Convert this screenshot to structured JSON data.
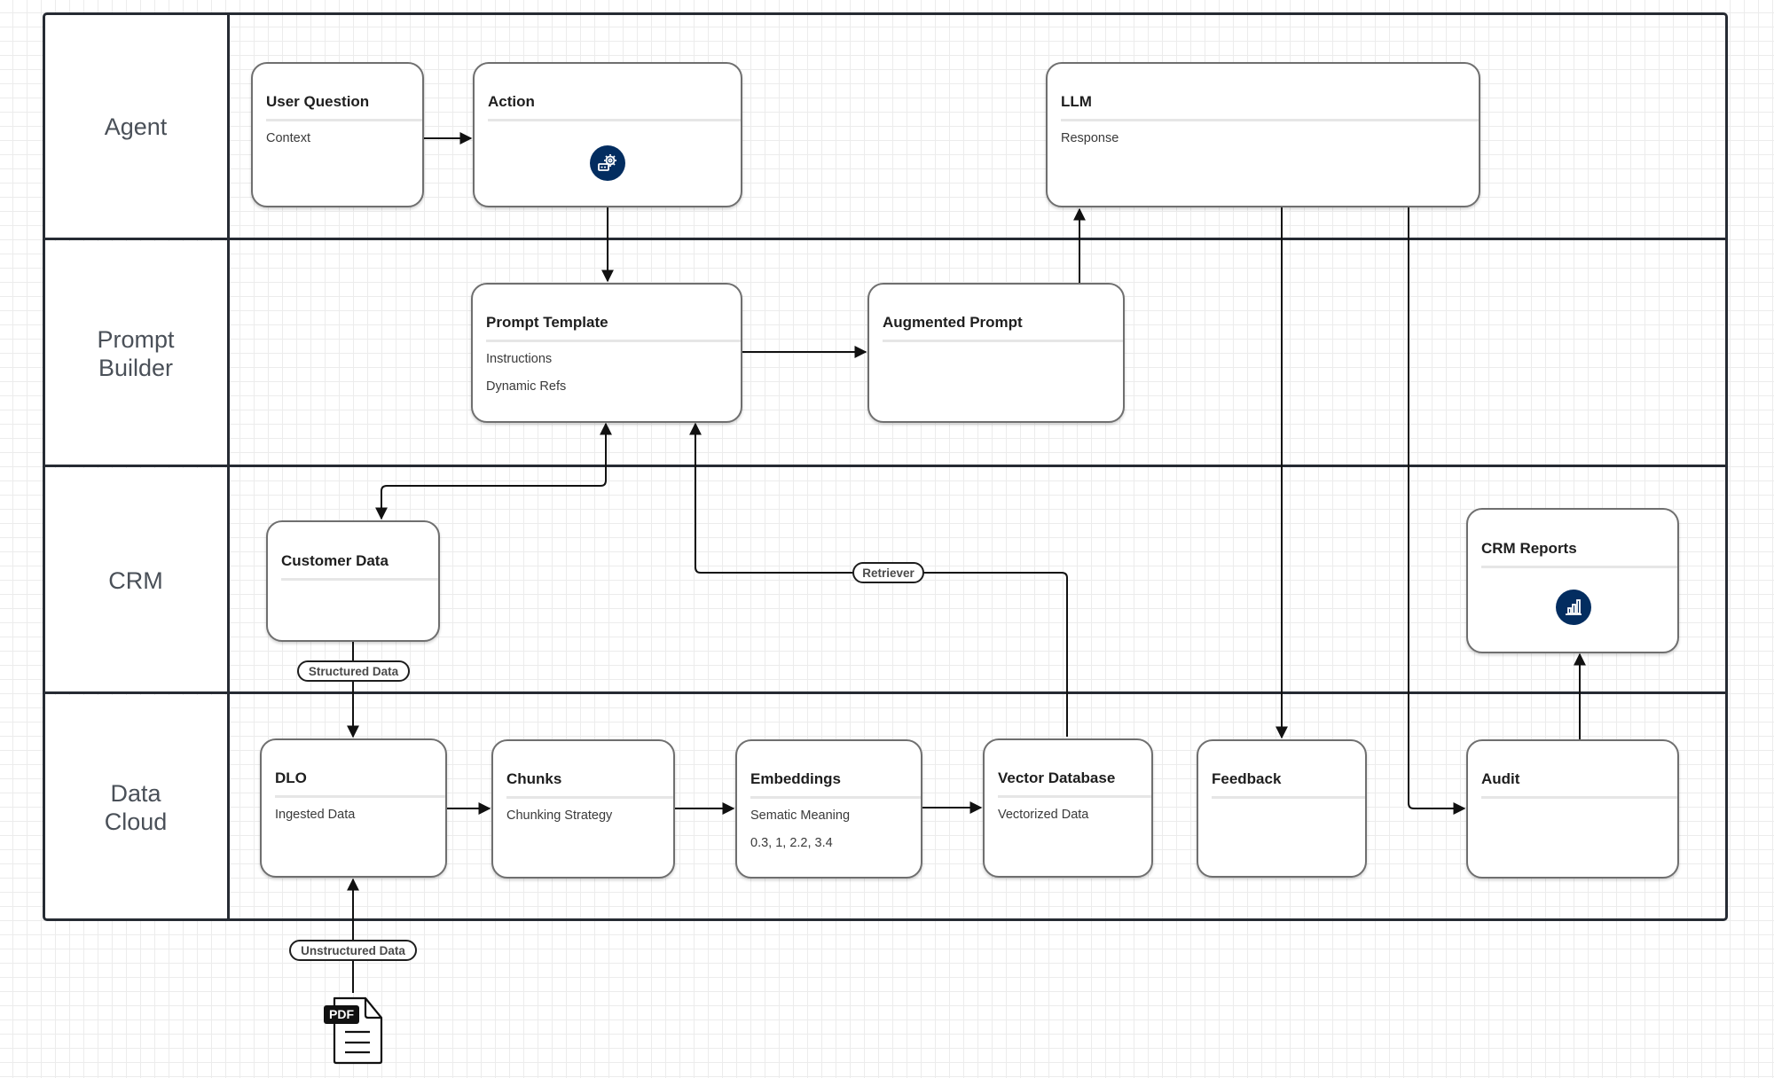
{
  "lanes": [
    {
      "id": "agent",
      "label_lines": [
        "Agent"
      ]
    },
    {
      "id": "prompt-builder",
      "label_lines": [
        "Prompt",
        "Builder"
      ]
    },
    {
      "id": "crm",
      "label_lines": [
        "CRM"
      ]
    },
    {
      "id": "data-cloud",
      "label_lines": [
        "Data",
        "Cloud"
      ]
    }
  ],
  "nodes": {
    "user_question": {
      "title": "User Question",
      "lines": [
        "Context"
      ]
    },
    "action": {
      "title": "Action",
      "icon": "action-gear-icon"
    },
    "llm": {
      "title": "LLM",
      "lines": [
        "Response"
      ]
    },
    "prompt_template": {
      "title": "Prompt Template",
      "lines": [
        "Instructions",
        "Dynamic Refs"
      ]
    },
    "augmented_prompt": {
      "title": "Augmented Prompt",
      "lines": []
    },
    "customer_data": {
      "title": "Customer Data",
      "lines": []
    },
    "crm_reports": {
      "title": "CRM Reports",
      "icon": "bar-chart-icon"
    },
    "dlo": {
      "title": "DLO",
      "lines": [
        "Ingested Data"
      ]
    },
    "chunks": {
      "title": "Chunks",
      "lines": [
        "Chunking Strategy"
      ]
    },
    "embeddings": {
      "title": "Embeddings",
      "lines": [
        "Sematic Meaning",
        "0.3, 1, 2.2, 3.4"
      ]
    },
    "vector_database": {
      "title": "Vector Database",
      "lines": [
        "Vectorized Data"
      ]
    },
    "feedback": {
      "title": "Feedback",
      "lines": []
    },
    "audit": {
      "title": "Audit",
      "lines": []
    }
  },
  "edge_labels": {
    "retriever": "Retriever",
    "structured_data": "Structured Data",
    "unstructured_data": "Unstructured Data"
  },
  "pdf_icon": {
    "label": "PDF"
  },
  "colors": {
    "icon_fill": "#032d60",
    "lane_border": "#262b33",
    "node_border": "#6f6f6f",
    "connector": "#111111"
  }
}
